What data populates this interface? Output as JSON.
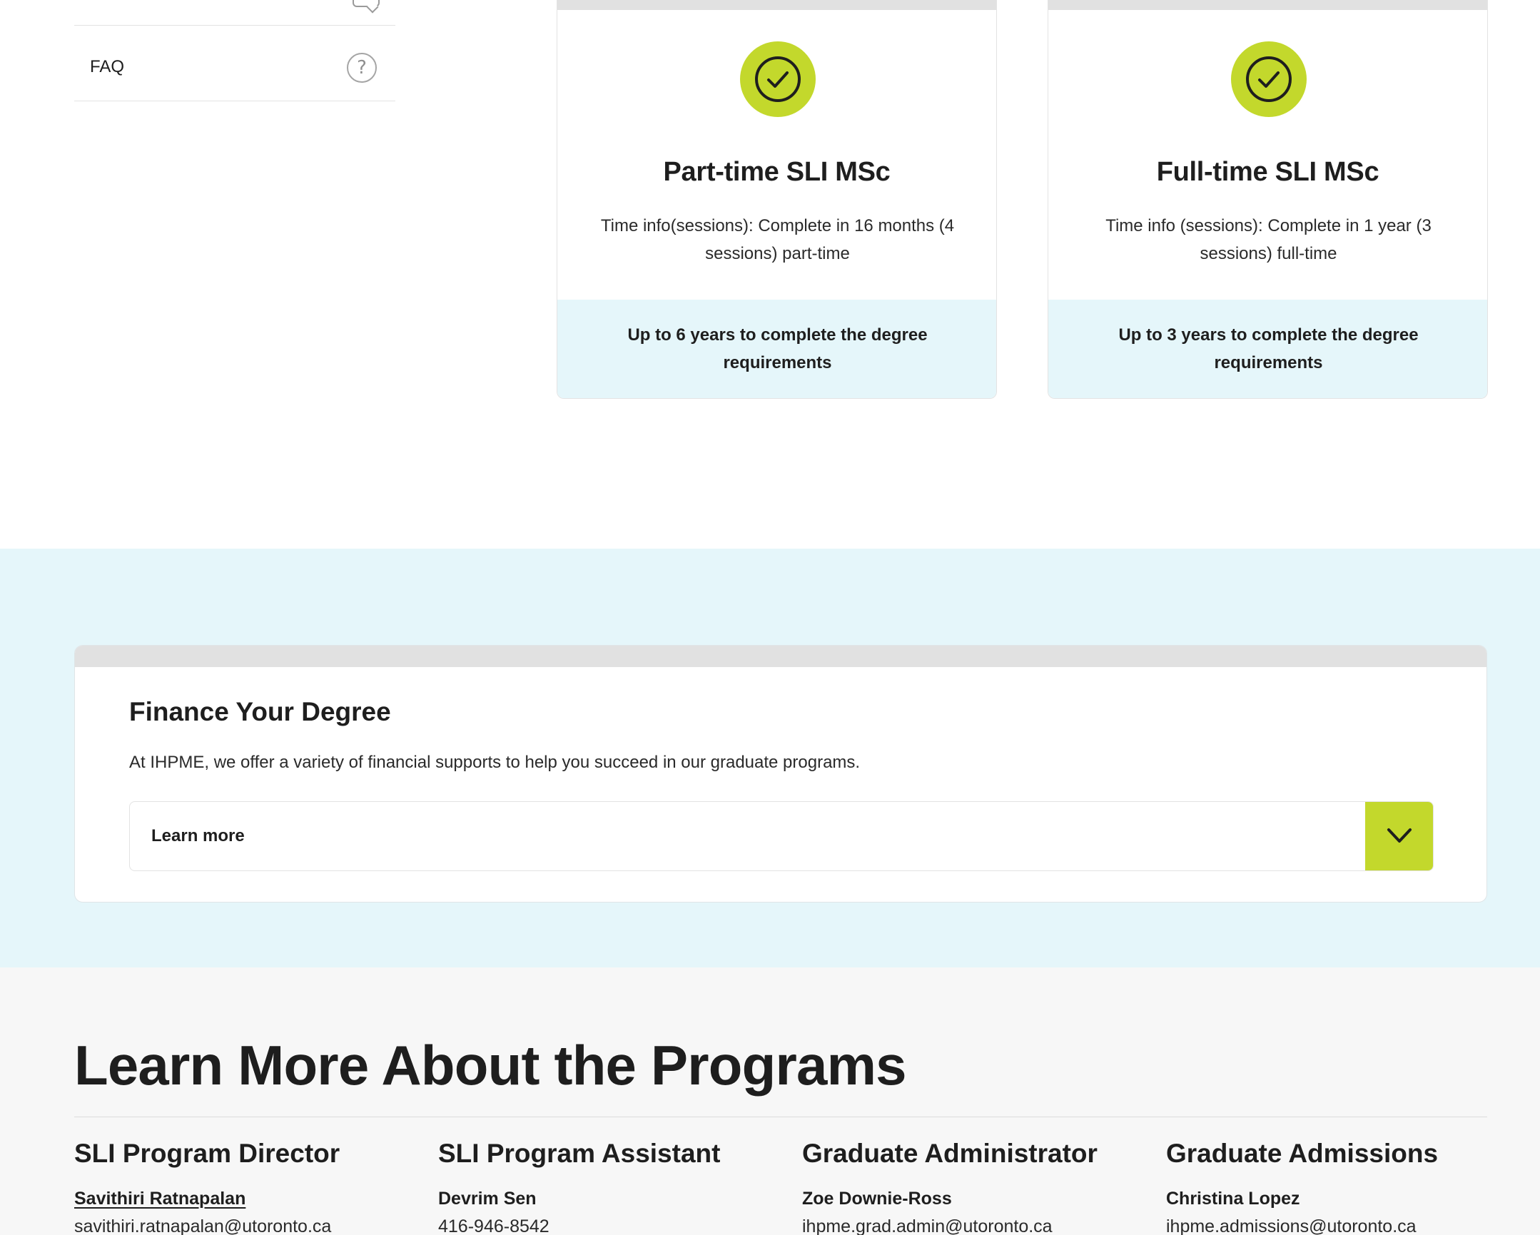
{
  "sidebar": {
    "items": [
      {
        "label": "",
        "icon": "chat-icon"
      },
      {
        "label": "FAQ",
        "icon": "question-circle-icon"
      }
    ]
  },
  "programs": [
    {
      "title": "Part-time SLI MSc",
      "time_info": "Time info(sessions): Complete in 16 months (4 sessions) part-time",
      "footer": "Up to 6 years to complete the degree requirements",
      "icon": "check-circle-icon"
    },
    {
      "title": "Full-time SLI MSc",
      "time_info": "Time info (sessions): Complete in 1 year (3 sessions) full-time",
      "footer": "Up to 3 years to complete the degree requirements",
      "icon": "check-circle-icon"
    }
  ],
  "finance": {
    "title": "Finance Your Degree",
    "text": "At IHPME, we offer a variety of financial supports to help you succeed in our graduate programs.",
    "accordion_label": "Learn more",
    "accordion_icon": "chevron-down-icon"
  },
  "learn_more": {
    "title": "Learn More About the Programs",
    "contacts": [
      {
        "role": "SLI Program Director",
        "name": "Savithiri Ratnapalan",
        "detail": "savithiri.ratnapalan@utoronto.ca"
      },
      {
        "role": "SLI Program Assistant",
        "name": "Devrim Sen",
        "detail": "416-946-8542"
      },
      {
        "role": "Graduate Administrator",
        "name": "Zoe Downie-Ross",
        "detail": "ihpme.grad.admin@utoronto.ca"
      },
      {
        "role": "Graduate Admissions",
        "name": "Christina Lopez",
        "detail": "ihpme.admissions@utoronto.ca"
      }
    ]
  },
  "colors": {
    "accent_lime": "#c3d82c",
    "light_blue_band": "#e5f6fa",
    "light_gray_band": "#f7f7f7",
    "text_dark": "#1e1e1e"
  }
}
